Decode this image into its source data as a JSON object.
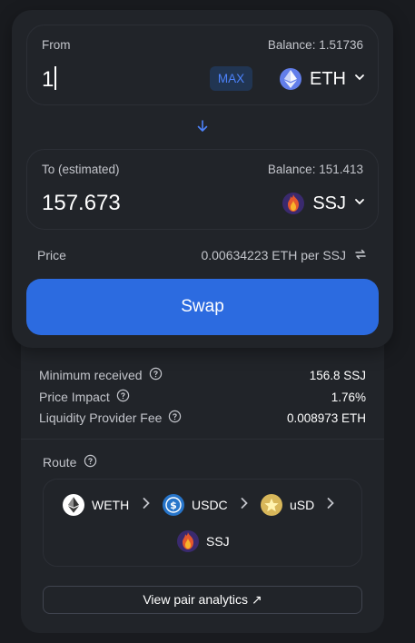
{
  "from": {
    "label": "From",
    "balance": "Balance: 1.51736",
    "amount": "1",
    "max_label": "MAX",
    "token": {
      "symbol": "ETH",
      "icon": "ethereum-icon"
    }
  },
  "to": {
    "label": "To (estimated)",
    "balance": "Balance: 151.413",
    "amount": "157.673",
    "token": {
      "symbol": "SSJ",
      "icon": "ssj-flame-icon"
    }
  },
  "price": {
    "label": "Price",
    "value": "0.00634223 ETH per SSJ"
  },
  "swap_button": "Swap",
  "details": {
    "minimum_received": {
      "label": "Minimum received",
      "value": "156.8 SSJ"
    },
    "price_impact": {
      "label": "Price Impact",
      "value": "1.76%"
    },
    "lp_fee": {
      "label": "Liquidity Provider Fee",
      "value": "0.008973 ETH"
    }
  },
  "route": {
    "label": "Route",
    "tokens": [
      {
        "symbol": "WETH",
        "icon": "weth-icon"
      },
      {
        "symbol": "USDC",
        "icon": "usdc-icon"
      },
      {
        "symbol": "uSD",
        "icon": "usd-star-icon"
      },
      {
        "symbol": "SSJ",
        "icon": "ssj-flame-icon"
      }
    ]
  },
  "analytics_button": "View pair analytics ↗",
  "colors": {
    "background": "#191b1f",
    "card": "#212429",
    "accent": "#2c6be0",
    "max_bg": "#213552",
    "max_text": "#4c82fb"
  }
}
